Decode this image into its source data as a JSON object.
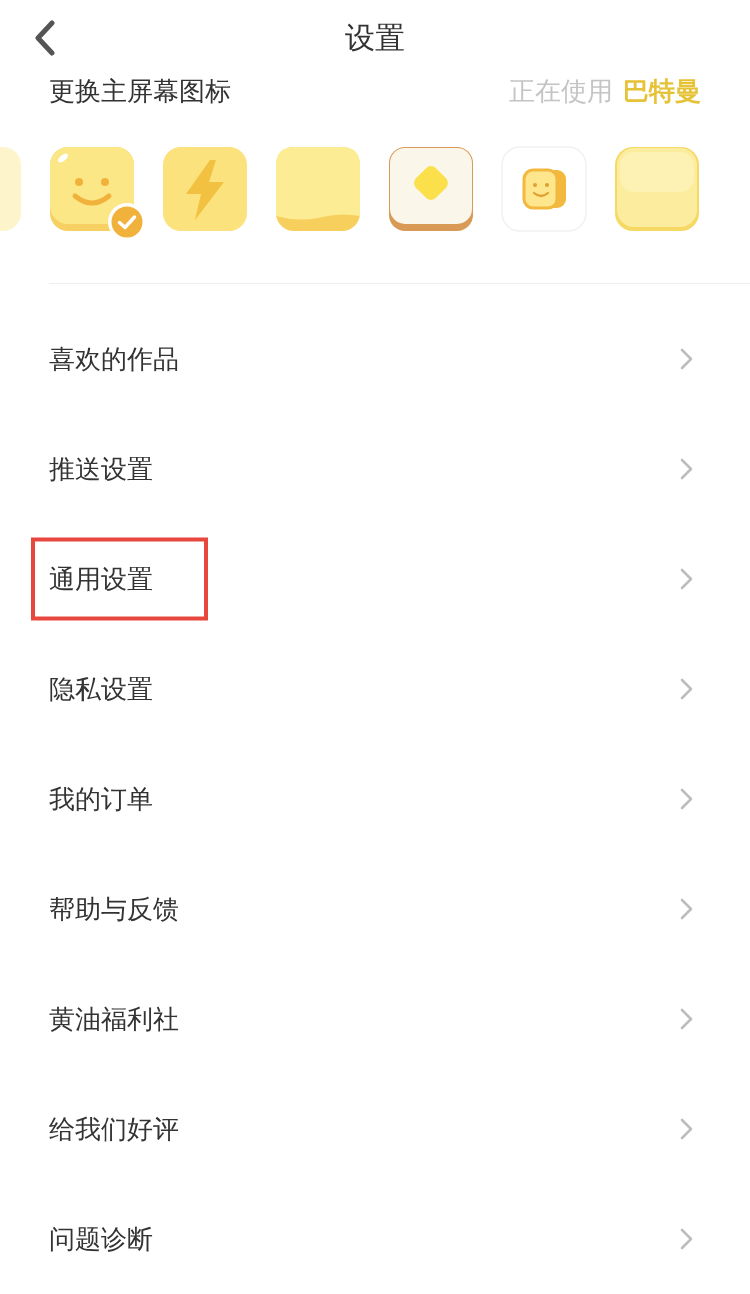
{
  "header": {
    "title": "设置"
  },
  "icon_section": {
    "title": "更换主屏幕图标",
    "status_label": "正在使用",
    "current_name": "巴特曼",
    "icons": [
      {
        "kind": "faded",
        "selected": false
      },
      {
        "kind": "smile",
        "selected": true
      },
      {
        "kind": "bolt",
        "selected": false
      },
      {
        "kind": "plain",
        "selected": false
      },
      {
        "kind": "toast",
        "selected": false
      },
      {
        "kind": "sticker",
        "selected": false
      },
      {
        "kind": "butter",
        "selected": false
      }
    ]
  },
  "menu": [
    {
      "label": "喜欢的作品",
      "highlighted": false
    },
    {
      "label": "推送设置",
      "highlighted": false
    },
    {
      "label": "通用设置",
      "highlighted": true
    },
    {
      "label": "隐私设置",
      "highlighted": false
    },
    {
      "label": "我的订单",
      "highlighted": false
    },
    {
      "label": "帮助与反馈",
      "highlighted": false
    },
    {
      "label": "黄油福利社",
      "highlighted": false
    },
    {
      "label": "给我们好评",
      "highlighted": false
    },
    {
      "label": "问题诊断",
      "highlighted": false
    }
  ]
}
